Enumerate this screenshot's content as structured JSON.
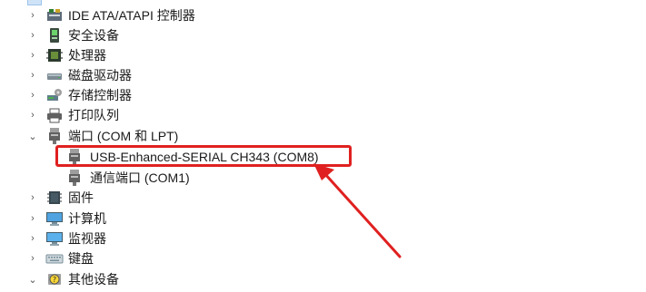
{
  "device_tree": {
    "items": [
      {
        "label": "IDE ATA/ATAPI 控制器",
        "icon": "ide-controller-icon",
        "expanded": false
      },
      {
        "label": "安全设备",
        "icon": "security-device-icon",
        "expanded": false
      },
      {
        "label": "处理器",
        "icon": "processor-icon",
        "expanded": false
      },
      {
        "label": "磁盘驱动器",
        "icon": "disk-drive-icon",
        "expanded": false
      },
      {
        "label": "存储控制器",
        "icon": "storage-controller-icon",
        "expanded": false
      },
      {
        "label": "打印队列",
        "icon": "printer-icon",
        "expanded": false
      },
      {
        "label": "端口 (COM 和 LPT)",
        "icon": "port-icon",
        "expanded": true,
        "children": [
          {
            "label": "USB-Enhanced-SERIAL CH343 (COM8)",
            "icon": "port-icon",
            "highlighted": true
          },
          {
            "label": "通信端口 (COM1)",
            "icon": "port-icon"
          }
        ]
      },
      {
        "label": "固件",
        "icon": "firmware-icon",
        "expanded": false
      },
      {
        "label": "计算机",
        "icon": "computer-icon",
        "expanded": false
      },
      {
        "label": "监视器",
        "icon": "monitor-icon",
        "expanded": false
      },
      {
        "label": "键盘",
        "icon": "keyboard-icon",
        "expanded": false
      },
      {
        "label": "其他设备",
        "icon": "warning-device-icon",
        "expanded": true
      }
    ]
  },
  "annotation": {
    "color": "#e02020"
  }
}
